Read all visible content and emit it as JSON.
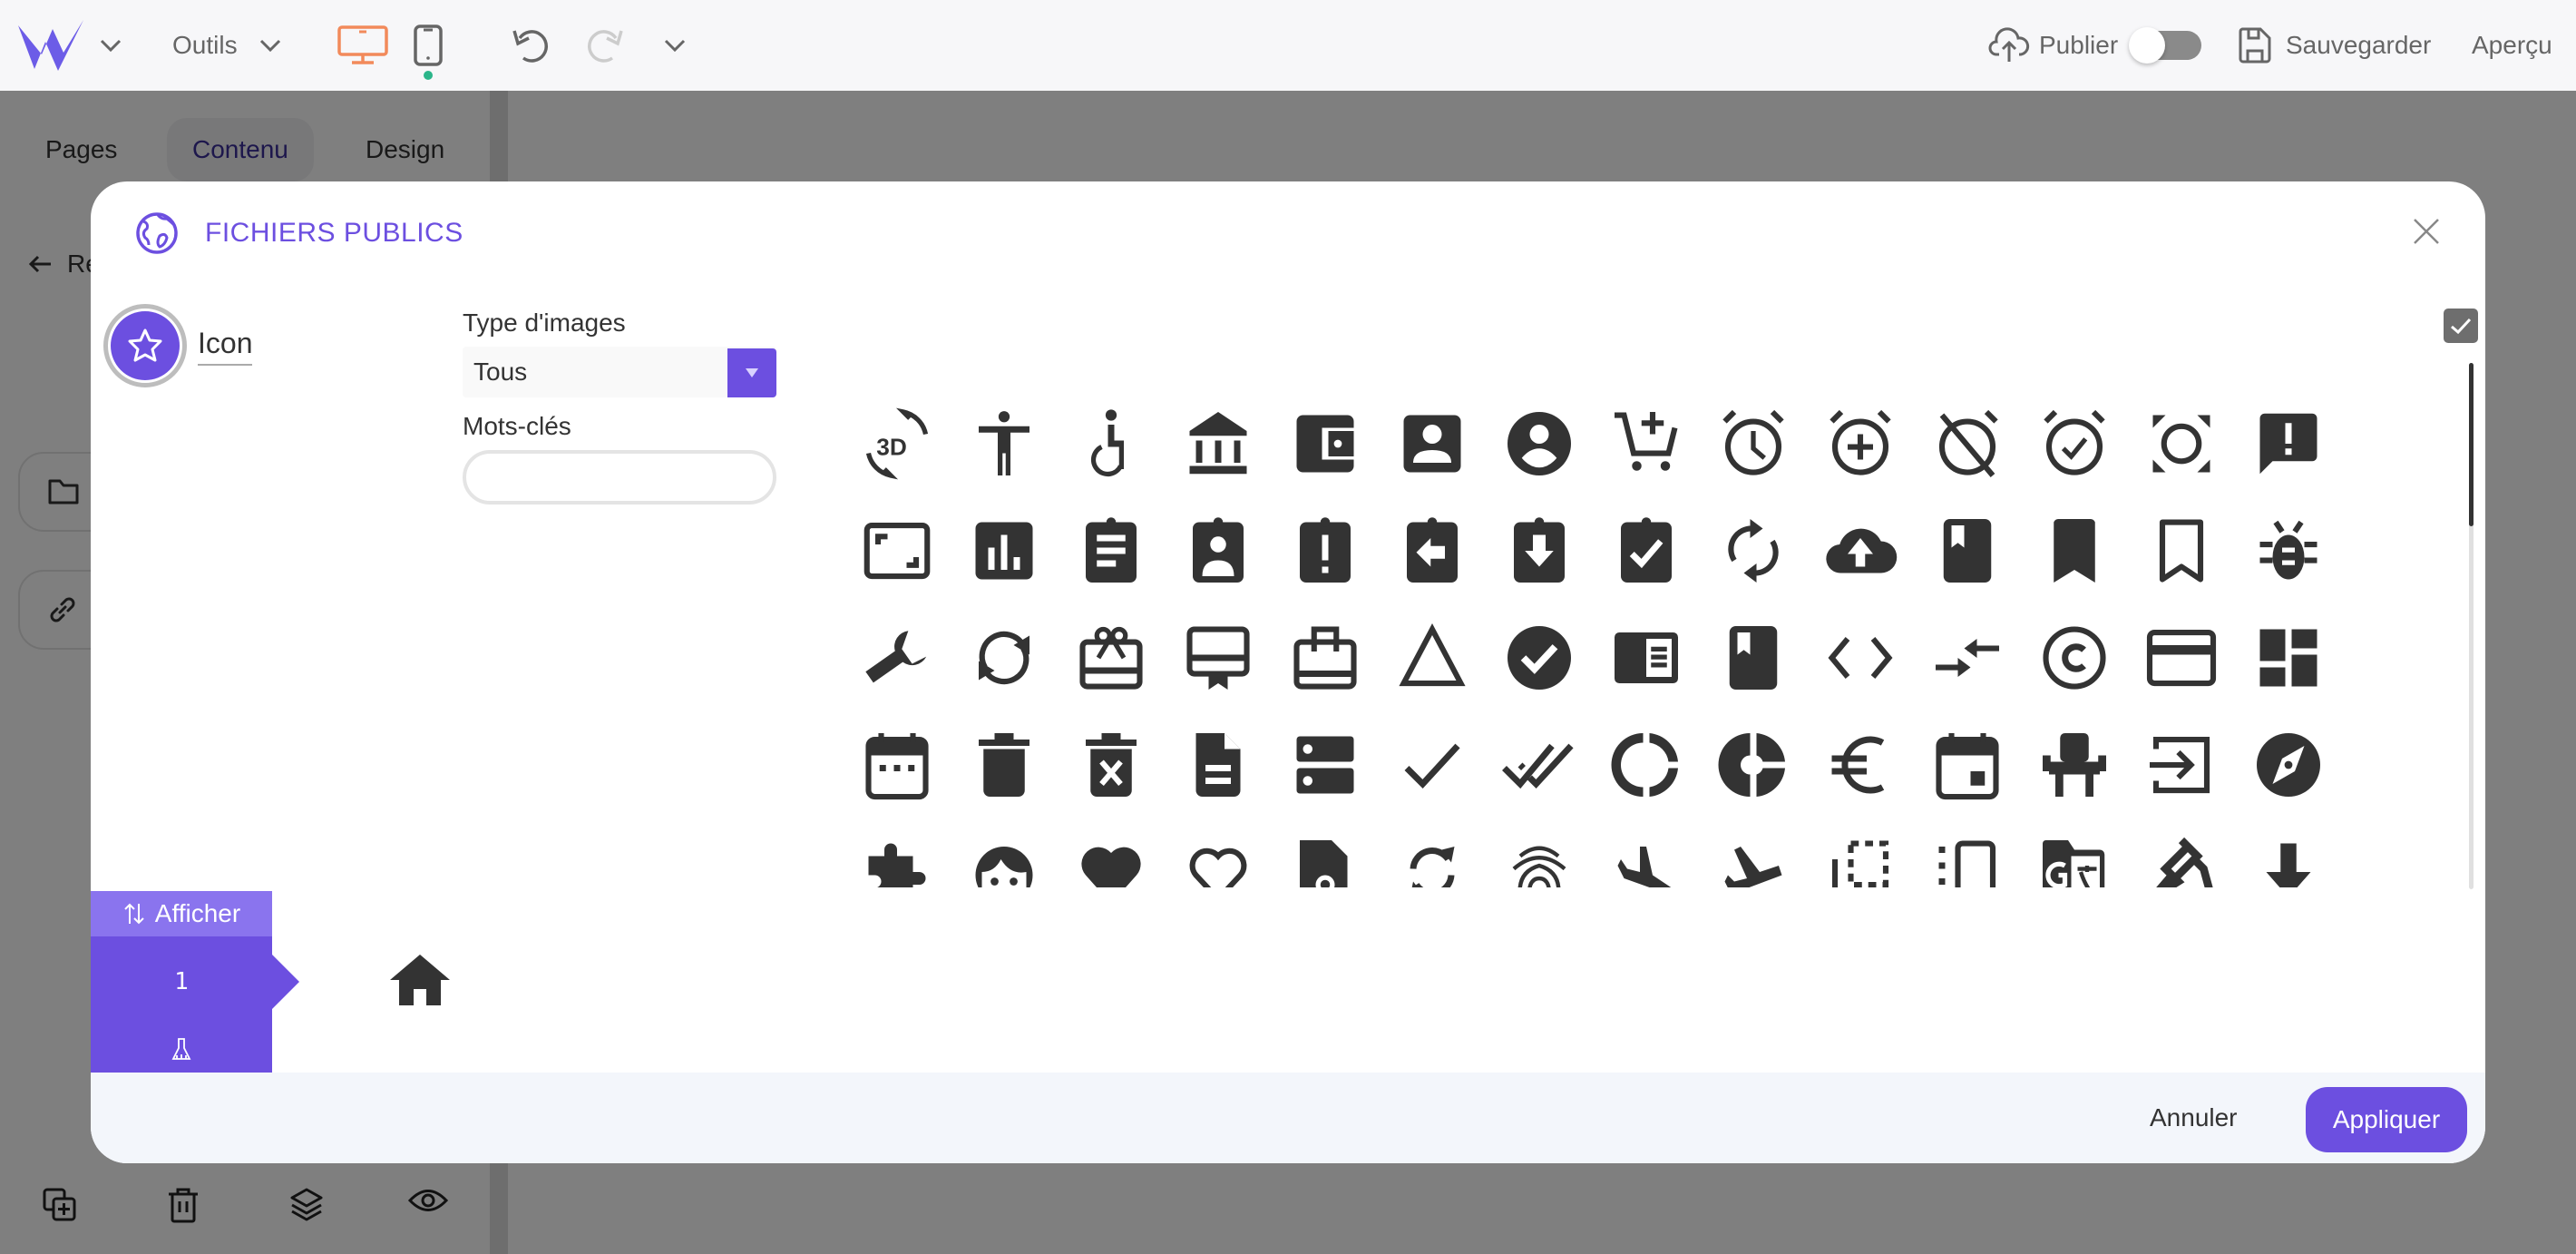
{
  "topbar": {
    "tools_label": "Outils",
    "publish_label": "Publier",
    "publish_enabled": false,
    "save_label": "Sauvegarder",
    "preview_label": "Aperçu",
    "active_device": "desktop",
    "colors": {
      "brand": "#6c5ce7",
      "desktop_active": "#f28a5b",
      "mobile_dot": "#2bb58a"
    }
  },
  "left_panel": {
    "tabs": [
      {
        "label": "Pages",
        "active": false
      },
      {
        "label": "Contenu",
        "active": true
      },
      {
        "label": "Design",
        "active": false
      }
    ],
    "back_label": "Re",
    "cards": [
      {
        "icon": "folder-icon"
      },
      {
        "icon": "link-icon"
      }
    ],
    "bottom_icons": [
      "duplicate-icon",
      "trash-icon",
      "layers-icon",
      "eye-icon"
    ]
  },
  "modal": {
    "title": "FICHIERS PUBLICS",
    "title_icon": "globe-icon",
    "selected_icon_label": "Icon",
    "filters": {
      "type_label": "Type d'images",
      "type_value": "Tous",
      "keywords_label": "Mots-clés",
      "keywords_value": "",
      "keywords_placeholder": ""
    },
    "select_all_checked": true,
    "icons": [
      "3d-rotation",
      "accessibility",
      "accessible",
      "account-balance",
      "account-balance-wallet",
      "account-box",
      "account-circle",
      "add-shopping-cart",
      "alarm",
      "alarm-add",
      "alarm-off",
      "alarm-on",
      "all-out",
      "announcement",
      "aspect-ratio",
      "assessment",
      "assignment",
      "assignment-ind",
      "assignment-late",
      "assignment-return",
      "assignment-returned",
      "assignment-turned-in",
      "autorenew",
      "backup",
      "book",
      "bookmark",
      "bookmark-border",
      "bug-report",
      "build",
      "cached",
      "card-giftcard",
      "card-membership",
      "card-travel",
      "change-history",
      "check-circle",
      "chrome-reader-mode",
      "class",
      "code",
      "compare-arrows",
      "copyright",
      "credit-card",
      "dashboard",
      "date-range",
      "delete",
      "delete-forever",
      "description",
      "dns",
      "done",
      "done-all",
      "donut-large",
      "donut-small",
      "euro-symbol",
      "event",
      "event-seat",
      "exit-to-app",
      "explore",
      "extension",
      "face",
      "favorite",
      "favorite-border",
      "feedback",
      "find-replace",
      "fingerprint",
      "flight-land",
      "flight-takeoff",
      "flip-to-back",
      "flip-to-front",
      "g-translate",
      "gavel",
      "get-app"
    ],
    "pager": {
      "show_label": "Afficher",
      "current_page": "1"
    },
    "preview_icon": "home",
    "footer": {
      "cancel_label": "Annuler",
      "apply_label": "Appliquer"
    }
  }
}
